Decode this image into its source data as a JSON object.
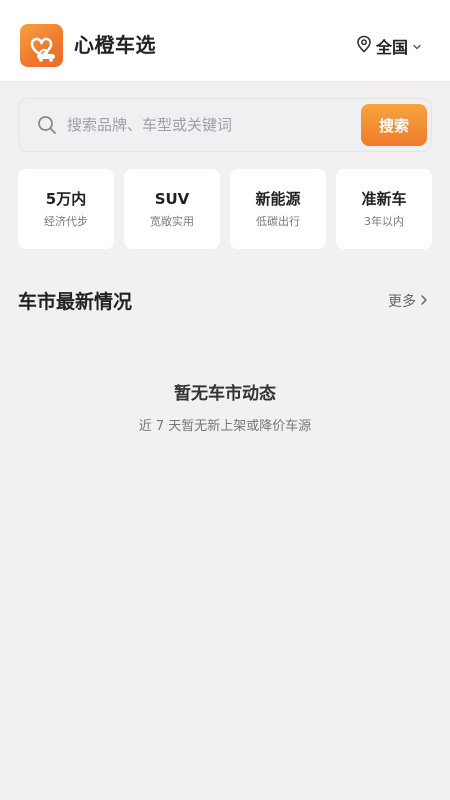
{
  "header": {
    "app_title": "心橙车选",
    "logo_icon": "heart-car-logo-icon",
    "location_label": "全国",
    "location_icon": "map-pin-icon",
    "dropdown_icon": "chevron-down-icon"
  },
  "search": {
    "placeholder": "搜索品牌、车型或关键词",
    "value": "",
    "button_label": "搜索",
    "icon": "search-icon"
  },
  "categories": [
    {
      "title": "5万内",
      "subtitle": "经济代步"
    },
    {
      "title": "SUV",
      "subtitle": "宽敞实用"
    },
    {
      "title": "新能源",
      "subtitle": "低碳出行"
    },
    {
      "title": "准新车",
      "subtitle": "3年以内"
    }
  ],
  "section": {
    "title": "车市最新情况",
    "more_label": "更多",
    "more_icon": "chevron-right-icon"
  },
  "empty_state": {
    "title": "暂无车市动态",
    "subtitle": "近 7 天暂无新上架或降价车源"
  },
  "colors": {
    "accent": "#f08a2f",
    "background": "#f2f1ef",
    "card": "#ffffff"
  }
}
